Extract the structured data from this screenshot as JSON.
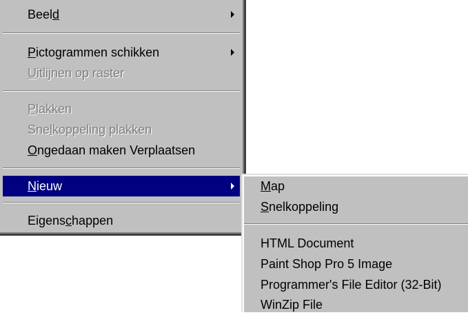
{
  "context_menu": {
    "items": [
      {
        "pre": "Beel",
        "key": "d",
        "post": "",
        "state": "enabled",
        "submenu": true
      },
      {
        "pre": "",
        "key": "P",
        "post": "ictogrammen schikken",
        "state": "enabled",
        "submenu": true
      },
      {
        "pre": "",
        "key": "U",
        "post": "itlijnen op raster",
        "state": "disabled",
        "submenu": false
      },
      {
        "pre": "",
        "key": "P",
        "post": "lakken",
        "state": "disabled",
        "submenu": false
      },
      {
        "pre": "Sne",
        "key": "l",
        "post": "koppeling plakken",
        "state": "disabled",
        "submenu": false
      },
      {
        "pre": "",
        "key": "O",
        "post": "ngedaan maken Verplaatsen",
        "state": "enabled",
        "submenu": false
      },
      {
        "pre": "",
        "key": "N",
        "post": "ieuw",
        "state": "selected",
        "submenu": true
      },
      {
        "pre": "Eigens",
        "key": "c",
        "post": "happen",
        "state": "enabled",
        "submenu": false
      }
    ]
  },
  "new_submenu": {
    "items": [
      {
        "pre": "",
        "key": "M",
        "post": "ap"
      },
      {
        "pre": "",
        "key": "S",
        "post": "nelkoppeling"
      },
      {
        "pre": "HTML Document",
        "key": "",
        "post": ""
      },
      {
        "pre": "Paint Shop Pro 5 Image",
        "key": "",
        "post": ""
      },
      {
        "pre": "Programmer's File Editor (32-Bit)",
        "key": "",
        "post": ""
      },
      {
        "pre": "WinZip File",
        "key": "",
        "post": ""
      }
    ]
  },
  "colors": {
    "menu_face": "#c0c0c0",
    "highlight": "#000080",
    "disabled_text": "#808080"
  }
}
